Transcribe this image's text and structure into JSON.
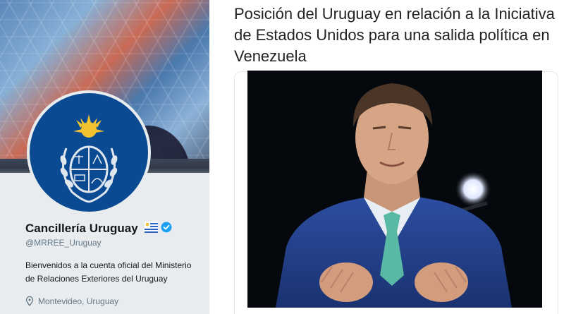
{
  "profile": {
    "display_name": "Cancillería Uruguay",
    "handle": "@MRREE_Uruguay",
    "bio": "Bienvenidos a la cuenta oficial del Ministerio de Relaciones Exteriores del Uruguay",
    "location": "Montevideo, Uruguay",
    "icons": {
      "flag": "uruguay-flag-icon",
      "verified": "verified-badge-icon",
      "location": "map-pin-icon"
    },
    "colors": {
      "avatar_bg": "#0a4a92",
      "verified": "#1da1f2",
      "secondary_text": "#657786"
    }
  },
  "article": {
    "headline": "Posición del Uruguay en relación a la Iniciativa de Estados Unidos para una salida política en Venezuela"
  }
}
